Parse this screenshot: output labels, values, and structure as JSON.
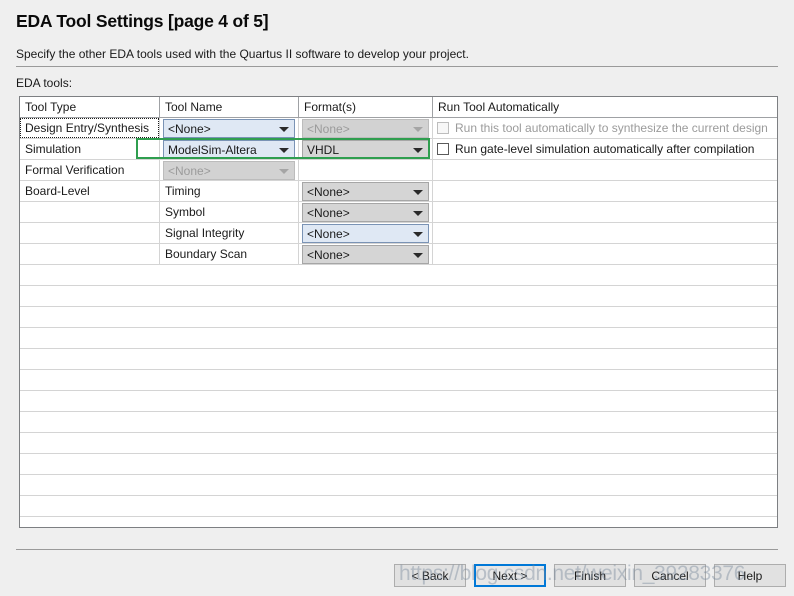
{
  "header": {
    "title": "EDA Tool Settings [page 4 of 5]",
    "subtitle": "Specify the other EDA tools used with the Quartus II software to develop your project."
  },
  "group_label": "EDA tools:",
  "table": {
    "columns": [
      "Tool Type",
      "Tool Name",
      "Format(s)",
      "Run Tool Automatically"
    ],
    "rows": [
      {
        "tool_type": "Design Entry/Synthesis",
        "tool_name": "<None>",
        "tool_name_state": "enabled",
        "format": "<None>",
        "format_state": "disabled",
        "checkbox_label": "Run this tool automatically to synthesize the current design",
        "checkbox_state": "disabled",
        "checked": false,
        "focused": true
      },
      {
        "tool_type": "Simulation",
        "tool_name": "ModelSim-Altera",
        "tool_name_state": "enabled",
        "format": "VHDL",
        "format_state": "gray",
        "checkbox_label": "Run gate-level simulation automatically after compilation",
        "checkbox_state": "enabled",
        "checked": false,
        "focused": false
      },
      {
        "tool_type": "Formal Verification",
        "tool_name": "<None>",
        "tool_name_state": "disabled",
        "format": "",
        "format_state": "none",
        "checkbox_label": "",
        "checkbox_state": "none",
        "checked": false,
        "focused": false
      },
      {
        "tool_type": "Board-Level",
        "sub_label": "Timing",
        "format": "<None>",
        "format_state": "gray",
        "checkbox_label": "",
        "checkbox_state": "none",
        "checked": false,
        "focused": false
      },
      {
        "tool_type": "",
        "sub_label": "Symbol",
        "format": "<None>",
        "format_state": "gray",
        "checkbox_label": "",
        "checkbox_state": "none",
        "checked": false,
        "focused": false
      },
      {
        "tool_type": "",
        "sub_label": "Signal Integrity",
        "format": "<None>",
        "format_state": "enabled",
        "checkbox_label": "",
        "checkbox_state": "none",
        "checked": false,
        "focused": false
      },
      {
        "tool_type": "",
        "sub_label": "Boundary Scan",
        "format": "<None>",
        "format_state": "gray",
        "checkbox_label": "",
        "checkbox_state": "none",
        "checked": false,
        "focused": false
      }
    ]
  },
  "footer": {
    "back": "< Back",
    "next": "Next >",
    "finish": "Finish",
    "cancel": "Cancel",
    "help": "Help"
  },
  "watermark": "https://blog.csdn.net/weixin_39283376",
  "colors": {
    "highlight_green": "#2f9e4f",
    "focus_blue": "#0078d7",
    "panel_bg": "#efefef",
    "combo_enabled_bg": "#dfe8f4",
    "combo_gray_bg": "#d5d5d5",
    "combo_disabled_bg": "#d2d2d2"
  }
}
